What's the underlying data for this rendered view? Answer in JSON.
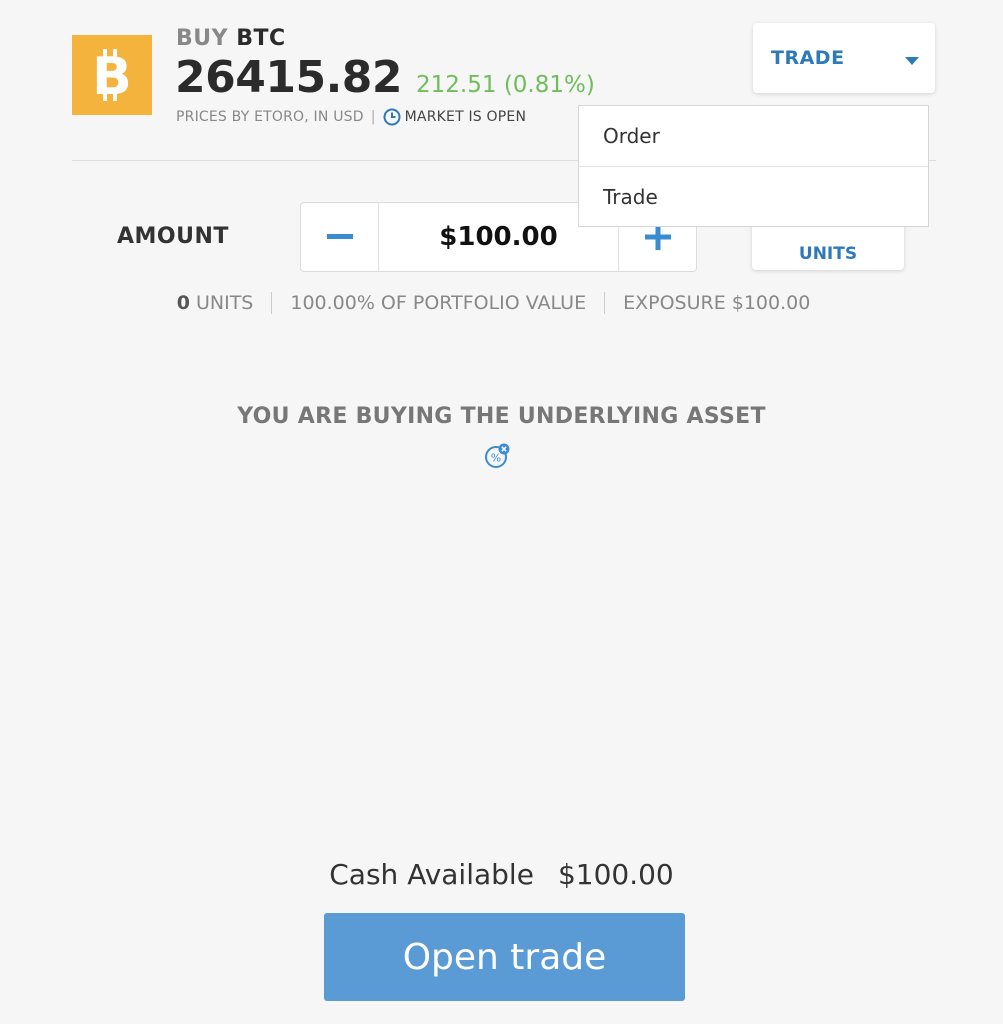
{
  "header": {
    "action": "BUY",
    "symbol": "BTC",
    "price": "26415.82",
    "change": "212.51 (0.81%)",
    "source": "PRICES BY ETORO, IN USD",
    "separator": "|",
    "market_status": "MARKET IS OPEN",
    "logo_icon": "bitcoin-icon",
    "logo_color": "#f3b33d",
    "change_color": "#6fbd5b"
  },
  "trade_dropdown": {
    "selected": "TRADE",
    "options": [
      "Order",
      "Trade"
    ]
  },
  "amount": {
    "label": "AMOUNT",
    "value": "$100.00",
    "units_toggle": "UNITS"
  },
  "info": {
    "units_count": "0",
    "units_label": "UNITS",
    "portfolio": "100.00% OF PORTFOLIO VALUE",
    "exposure": "EXPOSURE $100.00"
  },
  "notice": "YOU ARE BUYING THE UNDERLYING ASSET",
  "footer": {
    "cash_label": "Cash Available",
    "cash_value": "$100.00",
    "open_button": "Open trade"
  },
  "colors": {
    "accent": "#2e79b8",
    "button": "#5b9bd5"
  }
}
